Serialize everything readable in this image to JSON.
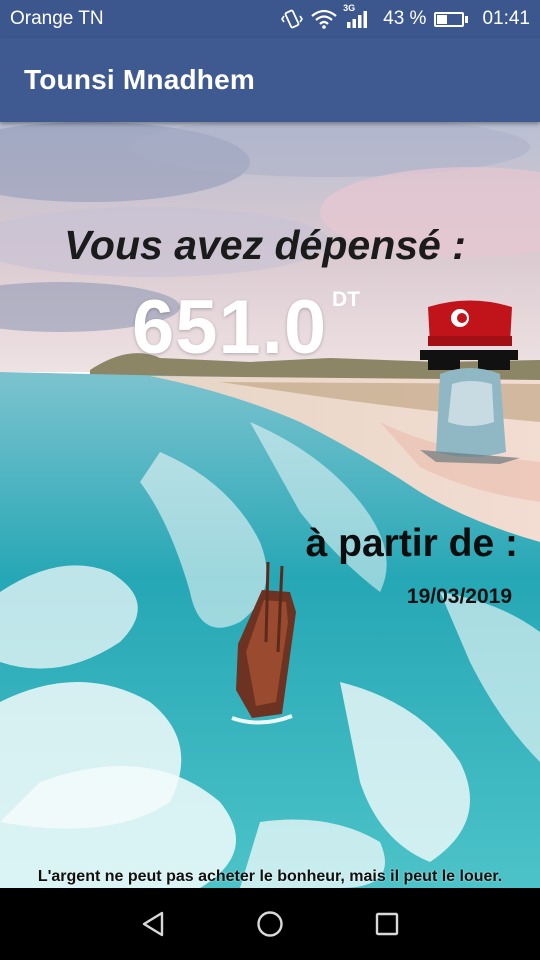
{
  "status_bar": {
    "carrier": "Orange TN",
    "network_type": "3G",
    "battery_percent": "43 %",
    "battery_level": 0.43,
    "time": "01:41",
    "icons": [
      "vibrate-icon",
      "wifi-icon",
      "signal-icon",
      "battery-icon"
    ]
  },
  "app_bar": {
    "title": "Tounsi Mnadhem"
  },
  "main": {
    "headline": "Vous avez dépensé :",
    "amount": "651.0",
    "currency": "DT",
    "since_label": "à partir de :",
    "since_date": "19/03/2019",
    "quote": "L'argent ne peut pas acheter le bonheur, mais il peut le louer."
  },
  "nav_bar": {
    "icons": [
      "back-icon",
      "home-icon",
      "recents-icon"
    ]
  },
  "colors": {
    "status_bar": "#3c578e",
    "app_bar": "#3f5a90",
    "sea": "#2ba6b4",
    "sand": "#e9d8cc"
  }
}
